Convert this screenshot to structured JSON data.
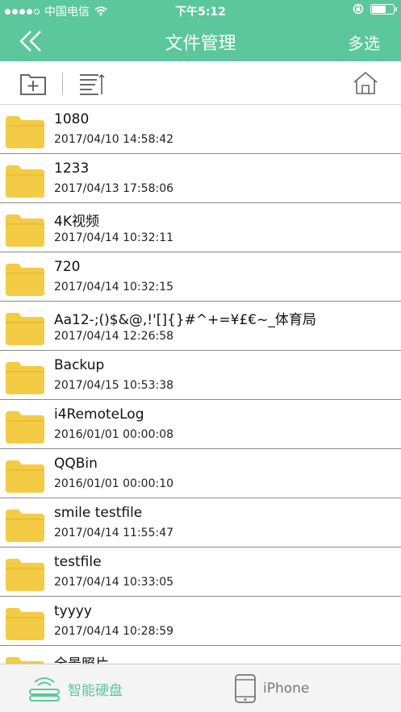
{
  "status_bar": {
    "carrier": "中国电信",
    "time": "下午5:12",
    "battery_level": 0.6
  },
  "nav": {
    "back_icon": "double-chevron-left-icon",
    "title": "文件管理",
    "action_label": "多选"
  },
  "toolbar": {
    "new_folder_icon": "new-folder-icon",
    "sort_icon": "sort-icon",
    "home_icon": "home-icon"
  },
  "files": [
    {
      "name": "1080",
      "date": "2017/04/10 14:58:42"
    },
    {
      "name": "1233",
      "date": "2017/04/13 17:58:06"
    },
    {
      "name": "4K视频",
      "date": "2017/04/14 10:32:11"
    },
    {
      "name": "720",
      "date": "2017/04/14 10:32:15"
    },
    {
      "name": "Aa12-;()$&@,!'[]{}#^+=¥£€~_体育局",
      "date": "2017/04/14 12:26:58"
    },
    {
      "name": "Backup",
      "date": "2017/04/15 10:53:38"
    },
    {
      "name": "i4RemoteLog",
      "date": "2016/01/01 00:00:08"
    },
    {
      "name": "QQBin",
      "date": "2016/01/01 00:00:10"
    },
    {
      "name": "smile testfile",
      "date": "2017/04/14 11:55:47"
    },
    {
      "name": "testfile",
      "date": "2017/04/14 10:33:05"
    },
    {
      "name": "tyyyy",
      "date": "2017/04/14 10:28:59"
    },
    {
      "name": "全景照片",
      "date": ""
    }
  ],
  "tabbar": {
    "disk_label": "智能硬盘",
    "phone_label": "iPhone"
  },
  "colors": {
    "accent": "#5cc79c",
    "folder": "#f4cb45"
  }
}
